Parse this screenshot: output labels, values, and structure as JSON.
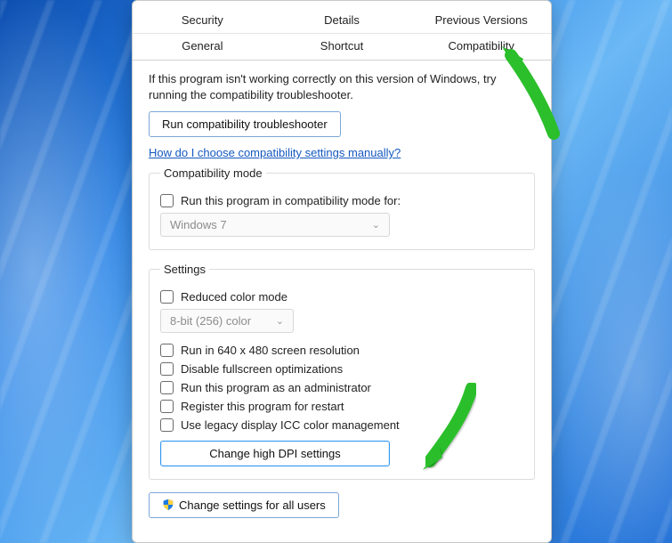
{
  "tabs": {
    "row1": [
      "Security",
      "Details",
      "Previous Versions"
    ],
    "row2": [
      "General",
      "Shortcut",
      "Compatibility"
    ],
    "active": "Compatibility"
  },
  "intro": "If this program isn't working correctly on this version of Windows, try running the compatibility troubleshooter.",
  "troubleshooter_btn": "Run compatibility troubleshooter",
  "help_link": "How do I choose compatibility settings manually?",
  "compat_mode": {
    "legend": "Compatibility mode",
    "checkbox": "Run this program in compatibility mode for:",
    "selected": "Windows 7"
  },
  "settings": {
    "legend": "Settings",
    "reduced_color": "Reduced color mode",
    "color_selected": "8-bit (256) color",
    "run640": "Run in 640 x 480 screen resolution",
    "disable_fullscreen": "Disable fullscreen optimizations",
    "run_admin": "Run this program as an administrator",
    "register_restart": "Register this program for restart",
    "legacy_icc": "Use legacy display ICC color management",
    "dpi_btn": "Change high DPI settings"
  },
  "all_users_btn": "Change settings for all users"
}
